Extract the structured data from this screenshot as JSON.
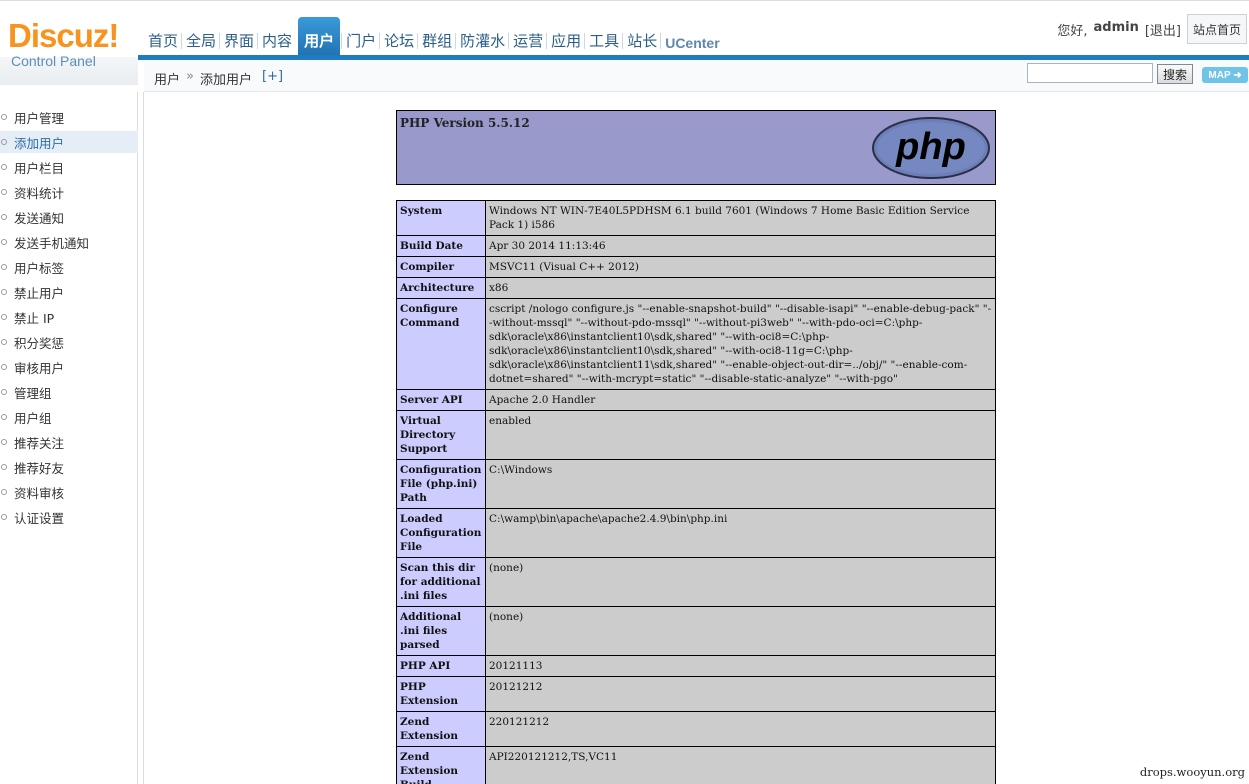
{
  "logo": {
    "brand": "Discuz!",
    "subtitle": "Control Panel"
  },
  "nav": {
    "items": [
      {
        "label": "首页",
        "active": false
      },
      {
        "label": "全局",
        "active": false
      },
      {
        "label": "界面",
        "active": false
      },
      {
        "label": "内容",
        "active": false
      },
      {
        "label": "用户",
        "active": true
      },
      {
        "label": "门户",
        "active": false
      },
      {
        "label": "论坛",
        "active": false
      },
      {
        "label": "群组",
        "active": false
      },
      {
        "label": "防灌水",
        "active": false
      },
      {
        "label": "运营",
        "active": false
      },
      {
        "label": "应用",
        "active": false
      },
      {
        "label": "工具",
        "active": false
      },
      {
        "label": "站长",
        "active": false
      },
      {
        "label": "UCenter",
        "active": false
      }
    ]
  },
  "userbar": {
    "greeting": "您好,",
    "username": "admin",
    "logout": "[退出]",
    "home": "站点首页"
  },
  "breadcrumb": {
    "section": "用户",
    "separator": "»",
    "page": "添加用户",
    "add": "[+]"
  },
  "search": {
    "value": "",
    "button": "搜索",
    "map": "MAP ➜"
  },
  "sidebar": {
    "items": [
      {
        "label": "用户管理",
        "active": false
      },
      {
        "label": "添加用户",
        "active": true
      },
      {
        "label": "用户栏目",
        "active": false
      },
      {
        "label": "资料统计",
        "active": false
      },
      {
        "label": "发送通知",
        "active": false
      },
      {
        "label": "发送手机通知",
        "active": false
      },
      {
        "label": "用户标签",
        "active": false
      },
      {
        "label": "禁止用户",
        "active": false
      },
      {
        "label": "禁止 IP",
        "active": false
      },
      {
        "label": "积分奖惩",
        "active": false
      },
      {
        "label": "审核用户",
        "active": false
      },
      {
        "label": "管理组",
        "active": false
      },
      {
        "label": "用户组",
        "active": false
      },
      {
        "label": "推荐关注",
        "active": false
      },
      {
        "label": "推荐好友",
        "active": false
      },
      {
        "label": "资料审核",
        "active": false
      },
      {
        "label": "认证设置",
        "active": false
      }
    ]
  },
  "phpinfo": {
    "version": "PHP Version 5.5.12",
    "logo_text": "php",
    "rows": [
      {
        "key": "System",
        "value": "Windows NT WIN-7E40L5PDHSM 6.1 build 7601 (Windows 7 Home Basic Edition Service Pack 1) i586"
      },
      {
        "key": "Build Date",
        "value": "Apr 30 2014 11:13:46"
      },
      {
        "key": "Compiler",
        "value": "MSVC11 (Visual C++ 2012)"
      },
      {
        "key": "Architecture",
        "value": "x86"
      },
      {
        "key": "Configure Command",
        "value": "cscript /nologo configure.js \"--enable-snapshot-build\" \"--disable-isapi\" \"--enable-debug-pack\" \"--without-mssql\" \"--without-pdo-mssql\" \"--without-pi3web\" \"--with-pdo-oci=C:\\php-sdk\\oracle\\x86\\instantclient10\\sdk,shared\" \"--with-oci8=C:\\php-sdk\\oracle\\x86\\instantclient10\\sdk,shared\" \"--with-oci8-11g=C:\\php-sdk\\oracle\\x86\\instantclient11\\sdk,shared\" \"--enable-object-out-dir=../obj/\" \"--enable-com-dotnet=shared\" \"--with-mcrypt=static\" \"--disable-static-analyze\" \"--with-pgo\""
      },
      {
        "key": "Server API",
        "value": "Apache 2.0 Handler"
      },
      {
        "key": "Virtual Directory Support",
        "value": "enabled"
      },
      {
        "key": "Configuration File (php.ini) Path",
        "value": "C:\\Windows"
      },
      {
        "key": "Loaded Configuration File",
        "value": "C:\\wamp\\bin\\apache\\apache2.4.9\\bin\\php.ini"
      },
      {
        "key": "Scan this dir for additional .ini files",
        "value": "(none)"
      },
      {
        "key": "Additional .ini files parsed",
        "value": "(none)"
      },
      {
        "key": "PHP API",
        "value": "20121113"
      },
      {
        "key": "PHP Extension",
        "value": "20121212"
      },
      {
        "key": "Zend Extension",
        "value": "220121212"
      },
      {
        "key": "Zend Extension Build",
        "value": "API220121212,TS,VC11"
      }
    ]
  },
  "watermark": "drops.wooyun.org"
}
